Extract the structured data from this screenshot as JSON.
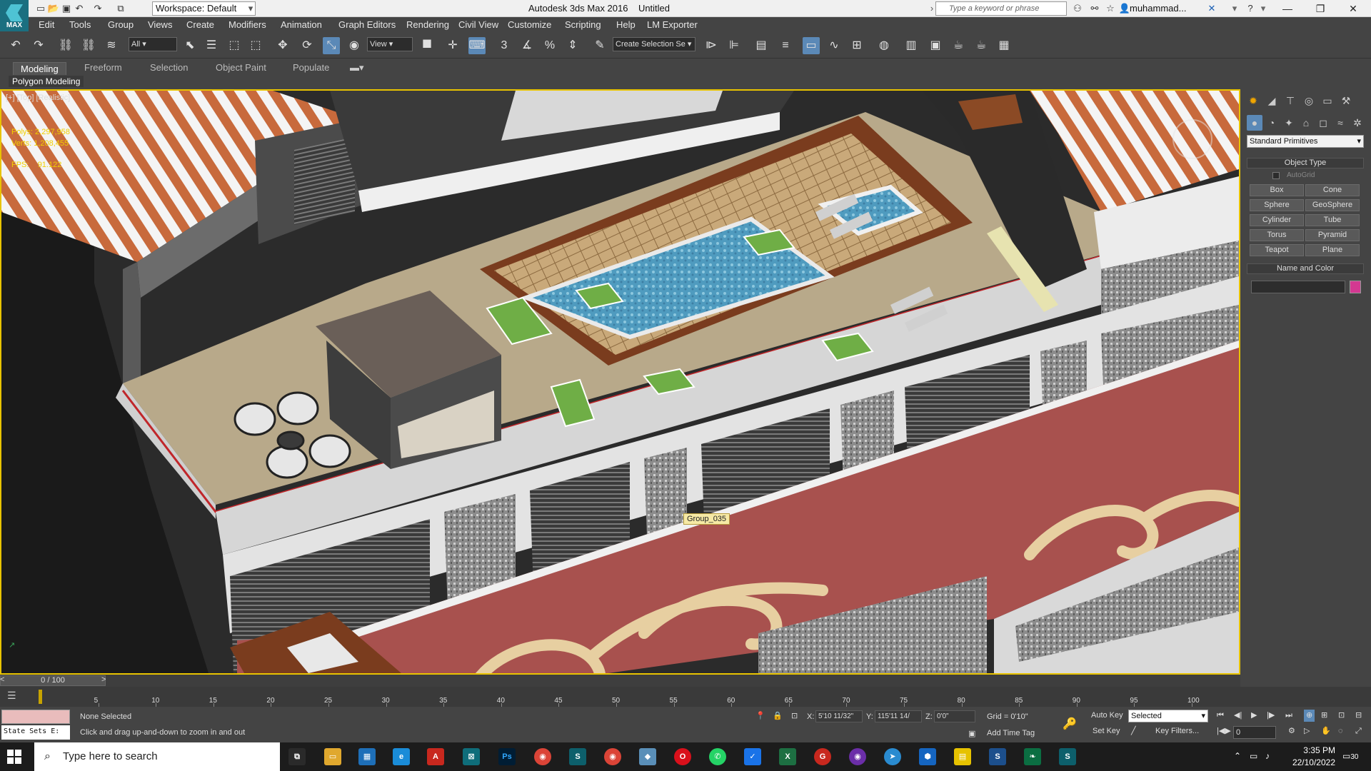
{
  "titlebar": {
    "workspace": "Workspace: Default",
    "app_title": "Autodesk 3ds Max 2016",
    "doc_title": "Untitled",
    "search_placeholder": "Type a keyword or phrase",
    "user": "muhammad...",
    "logo_text": "MAX"
  },
  "menu": [
    "Edit",
    "Tools",
    "Group",
    "Views",
    "Create",
    "Modifiers",
    "Animation",
    "Graph Editors",
    "Rendering",
    "Civil View",
    "Customize",
    "Scripting",
    "Help",
    "LM Exporter"
  ],
  "toolbar": {
    "filter": "All",
    "ref_coord": "View",
    "selection_set": "Create Selection Se"
  },
  "ribbon": {
    "tabs": [
      "Modeling",
      "Freeform",
      "Selection",
      "Object Paint",
      "Populate"
    ],
    "active_tab": "Modeling",
    "panel": "Polygon Modeling"
  },
  "viewport": {
    "label": "[+] [Top] [Realistic]",
    "stats": {
      "polys_label": "Polys:",
      "polys": "2,297,958",
      "verts_label": "Verts:",
      "verts": "1,208,455",
      "fps_label": "FPS:",
      "fps": "91.122"
    },
    "object_label": "Group_035"
  },
  "command_panel": {
    "category": "Standard Primitives",
    "object_type_title": "Object Type",
    "autogrid": "AutoGrid",
    "buttons": [
      "Box",
      "Cone",
      "Sphere",
      "GeoSphere",
      "Cylinder",
      "Tube",
      "Torus",
      "Pyramid",
      "Teapot",
      "Plane"
    ],
    "name_color_title": "Name and Color",
    "swatch_color": "#d33891"
  },
  "timeline": {
    "frame": "0 / 100",
    "ticks": [
      "5",
      "10",
      "15",
      "20",
      "25",
      "30",
      "35",
      "40",
      "45",
      "50",
      "55",
      "60",
      "65",
      "70",
      "75",
      "80",
      "85",
      "90",
      "95",
      "100"
    ]
  },
  "status": {
    "selection": "None Selected",
    "prompt": "Click and drag up-and-down to zoom in and out",
    "state_sets": "State Sets E:",
    "x": "5'10 11/32\"",
    "y": "115'11 14/",
    "z": "0'0\"",
    "grid": "Grid = 0'10\"",
    "add_time_tag": "Add Time Tag",
    "auto_key": "Auto Key",
    "set_key": "Set Key",
    "key_mode": "Selected",
    "key_filters": "Key Filters...",
    "current_frame": "0"
  },
  "taskbar": {
    "search": "Type here to search",
    "time": "3:35 PM",
    "date": "22/10/2022",
    "notification_count": "30"
  }
}
